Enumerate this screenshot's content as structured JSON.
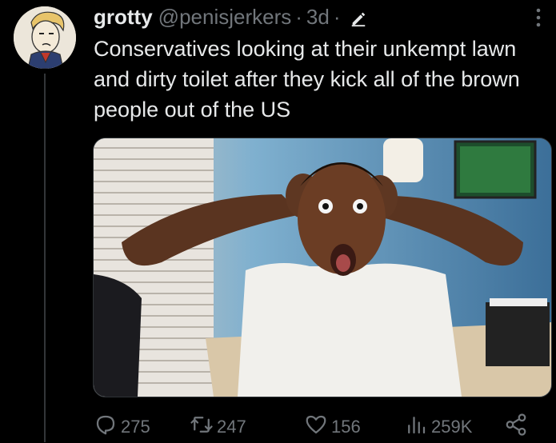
{
  "tweet": {
    "display_name": "grotty",
    "handle": "@penisjerkers",
    "separator": "·",
    "time": "3d",
    "time_separator": "·",
    "text": "Conservatives looking at their unkempt lawn and dirty toilet after they kick all of the brown people out of the US"
  },
  "actions": {
    "replies": "275",
    "retweets": "247",
    "likes": "156",
    "views": "259K"
  },
  "icons": {
    "reply": "comment-icon",
    "retweet": "retweet-icon",
    "like": "heart-icon",
    "views": "views-chart-icon",
    "share": "share-icon",
    "more": "more-dots-icon",
    "edit": "edit-pencil-icon"
  },
  "colors": {
    "background": "#000000",
    "text": "#e7e9ea",
    "muted": "#71767b"
  }
}
